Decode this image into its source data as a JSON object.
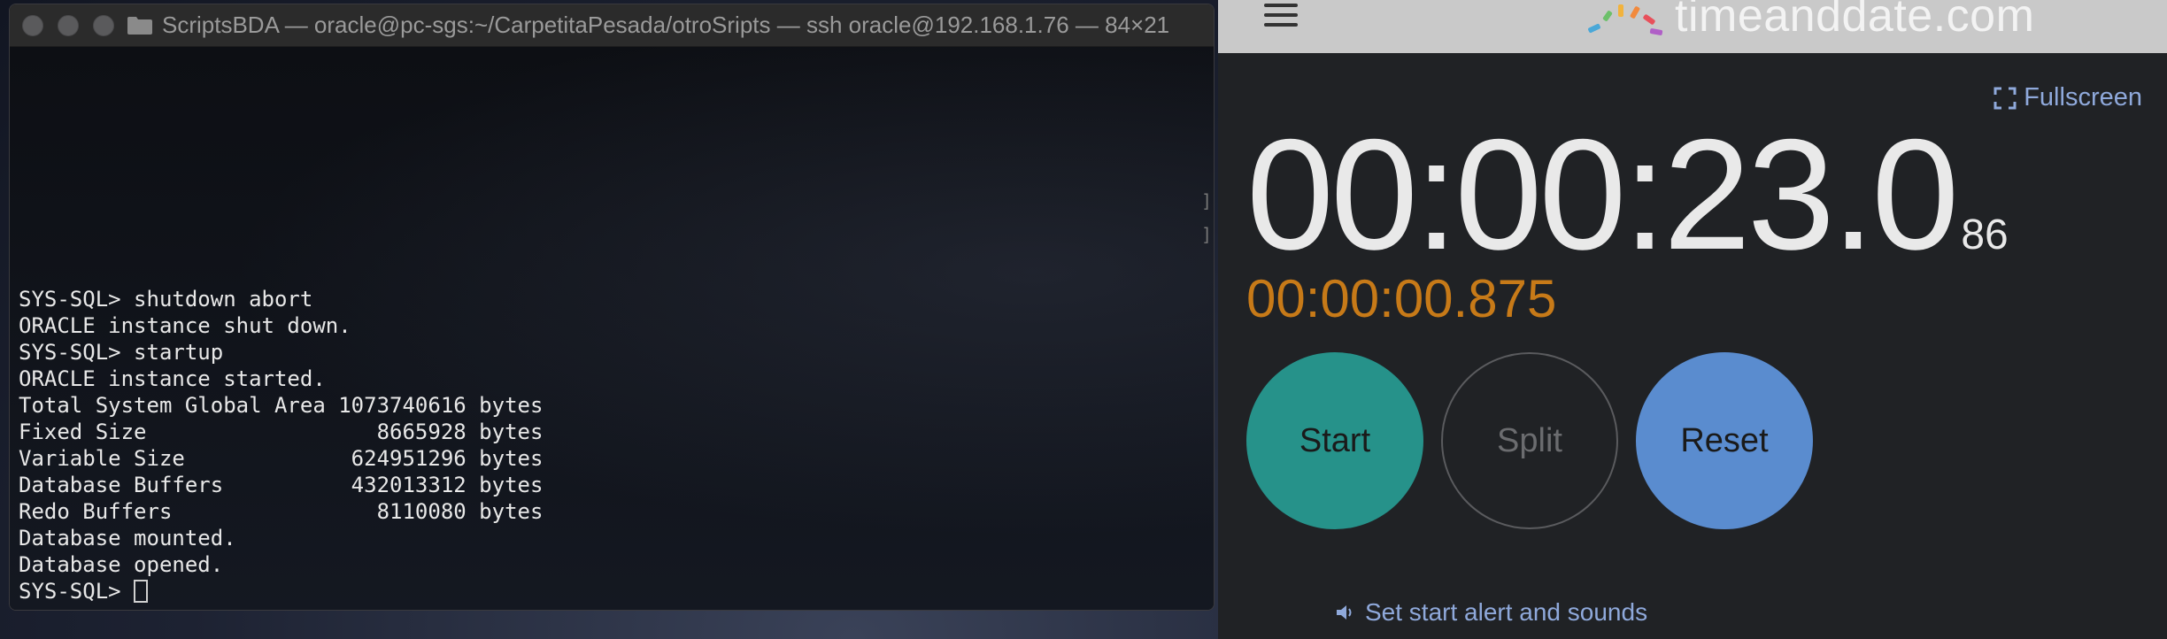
{
  "terminal": {
    "title": "ScriptsBDA — oracle@pc-sgs:~/CarpetitaPesada/otroSripts — ssh oracle@192.168.1.76 — 84×21",
    "lines": [
      "SYS-SQL> shutdown abort",
      "ORACLE instance shut down.",
      "SYS-SQL> startup",
      "ORACLE instance started.",
      "Total System Global Area 1073740616 bytes",
      "Fixed Size                  8665928 bytes",
      "Variable Size             624951296 bytes",
      "Database Buffers          432013312 bytes",
      "Redo Buffers                8110080 bytes",
      "Database mounted.",
      "Database opened.",
      "SYS-SQL> "
    ]
  },
  "site": {
    "logo_text": "timeanddate.com",
    "fullscreen_label": "Fullscreen",
    "main_time": "00:00:23.0",
    "main_time_ms": "86",
    "lap_time": "00:00:00.875",
    "start_label": "Start",
    "split_label": "Split",
    "reset_label": "Reset",
    "alert_label": "Set start alert and sounds"
  },
  "colors": {
    "start": "#26928a",
    "reset": "#5a8ccf",
    "lap": "#c77a18",
    "link": "#8fa9db"
  },
  "icons": [
    "folder-icon",
    "hamburger-icon",
    "fullscreen-icon",
    "speaker-icon",
    "timeanddate-logo-icon"
  ]
}
